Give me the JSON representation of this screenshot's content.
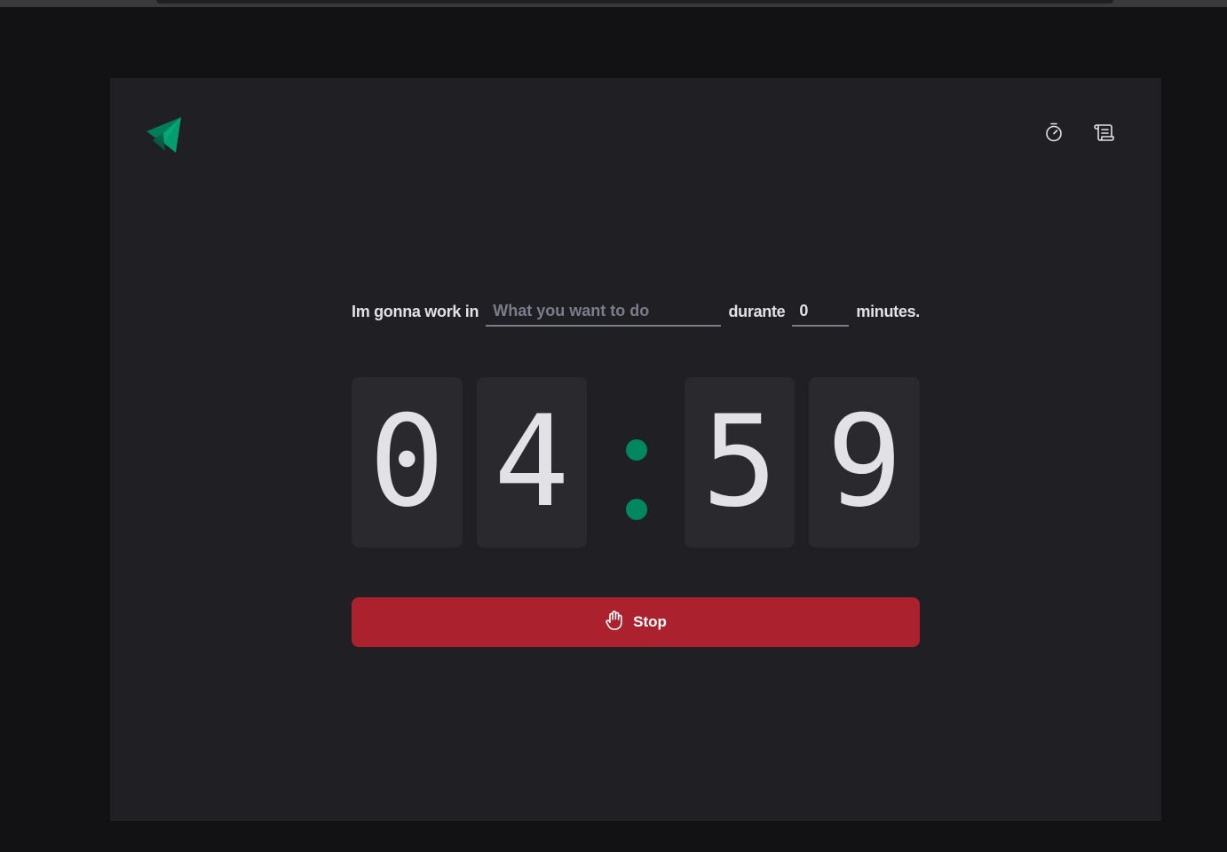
{
  "header": {
    "nav": [
      {
        "icon": "timer-icon",
        "label": ""
      },
      {
        "icon": "scroll-icon",
        "label": ""
      }
    ]
  },
  "form": {
    "task_label": "Im gonna work in",
    "task_placeholder": "What you want to do",
    "task_value": "",
    "duration_label": "durante",
    "minutes_value": "0",
    "minutes_suffix": "minutes."
  },
  "countdown": {
    "minutes": [
      "0",
      "4"
    ],
    "seconds": [
      "5",
      "9"
    ]
  },
  "stop_button": {
    "label": "Stop",
    "icon": "hand-palm-icon"
  },
  "colors": {
    "background": "#121214",
    "panel": "#202024",
    "digit_box": "#29292e",
    "text": "#e1e1e6",
    "accent_green": "#00875f",
    "stop_red": "#ab222e"
  }
}
